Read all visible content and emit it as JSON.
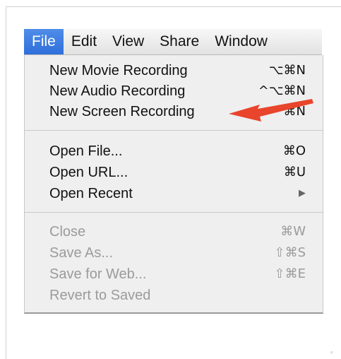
{
  "menubar": {
    "items": [
      {
        "label": "File",
        "active": true
      },
      {
        "label": "Edit"
      },
      {
        "label": "View"
      },
      {
        "label": "Share"
      },
      {
        "label": "Window"
      }
    ]
  },
  "file_menu": {
    "group1": [
      {
        "label": "New Movie Recording",
        "shortcut": "⌥⌘N"
      },
      {
        "label": "New Audio Recording",
        "shortcut": "^⌥⌘N"
      },
      {
        "label": "New Screen Recording",
        "shortcut": "^⌘N"
      }
    ],
    "group2": [
      {
        "label": "Open File...",
        "shortcut": "⌘O"
      },
      {
        "label": "Open URL...",
        "shortcut": "⌘U"
      },
      {
        "label": "Open Recent",
        "shortcut": "▶"
      }
    ],
    "group3": [
      {
        "label": "Close",
        "shortcut": "⌘W",
        "disabled": true
      },
      {
        "label": "Save As...",
        "shortcut": "⇧⌘S",
        "disabled": true
      },
      {
        "label": "Save for Web...",
        "shortcut": "⇧⌘E",
        "disabled": true
      },
      {
        "label": "Revert to Saved",
        "shortcut": "",
        "disabled": true
      }
    ]
  },
  "annotation": {
    "arrow_color": "#e8452c",
    "icon": "red-pointer-arrow-icon"
  },
  "colors": {
    "menubar_highlight": "#2f6fdb",
    "disabled_text": "#9b9b9b"
  }
}
